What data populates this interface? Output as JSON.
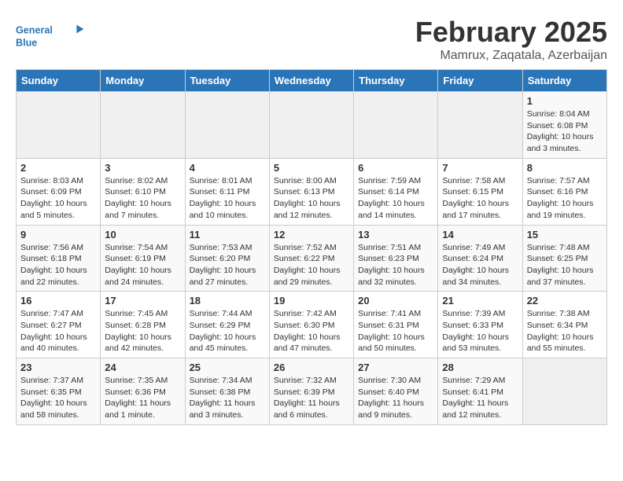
{
  "header": {
    "logo": {
      "general": "General",
      "blue": "Blue"
    },
    "title": "February 2025",
    "subtitle": "Mamrux, Zaqatala, Azerbaijan"
  },
  "calendar": {
    "weekdays": [
      "Sunday",
      "Monday",
      "Tuesday",
      "Wednesday",
      "Thursday",
      "Friday",
      "Saturday"
    ],
    "weeks": [
      [
        {
          "day": "",
          "info": ""
        },
        {
          "day": "",
          "info": ""
        },
        {
          "day": "",
          "info": ""
        },
        {
          "day": "",
          "info": ""
        },
        {
          "day": "",
          "info": ""
        },
        {
          "day": "",
          "info": ""
        },
        {
          "day": "1",
          "info": "Sunrise: 8:04 AM\nSunset: 6:08 PM\nDaylight: 10 hours and 3 minutes."
        }
      ],
      [
        {
          "day": "2",
          "info": "Sunrise: 8:03 AM\nSunset: 6:09 PM\nDaylight: 10 hours and 5 minutes."
        },
        {
          "day": "3",
          "info": "Sunrise: 8:02 AM\nSunset: 6:10 PM\nDaylight: 10 hours and 7 minutes."
        },
        {
          "day": "4",
          "info": "Sunrise: 8:01 AM\nSunset: 6:11 PM\nDaylight: 10 hours and 10 minutes."
        },
        {
          "day": "5",
          "info": "Sunrise: 8:00 AM\nSunset: 6:13 PM\nDaylight: 10 hours and 12 minutes."
        },
        {
          "day": "6",
          "info": "Sunrise: 7:59 AM\nSunset: 6:14 PM\nDaylight: 10 hours and 14 minutes."
        },
        {
          "day": "7",
          "info": "Sunrise: 7:58 AM\nSunset: 6:15 PM\nDaylight: 10 hours and 17 minutes."
        },
        {
          "day": "8",
          "info": "Sunrise: 7:57 AM\nSunset: 6:16 PM\nDaylight: 10 hours and 19 minutes."
        }
      ],
      [
        {
          "day": "9",
          "info": "Sunrise: 7:56 AM\nSunset: 6:18 PM\nDaylight: 10 hours and 22 minutes."
        },
        {
          "day": "10",
          "info": "Sunrise: 7:54 AM\nSunset: 6:19 PM\nDaylight: 10 hours and 24 minutes."
        },
        {
          "day": "11",
          "info": "Sunrise: 7:53 AM\nSunset: 6:20 PM\nDaylight: 10 hours and 27 minutes."
        },
        {
          "day": "12",
          "info": "Sunrise: 7:52 AM\nSunset: 6:22 PM\nDaylight: 10 hours and 29 minutes."
        },
        {
          "day": "13",
          "info": "Sunrise: 7:51 AM\nSunset: 6:23 PM\nDaylight: 10 hours and 32 minutes."
        },
        {
          "day": "14",
          "info": "Sunrise: 7:49 AM\nSunset: 6:24 PM\nDaylight: 10 hours and 34 minutes."
        },
        {
          "day": "15",
          "info": "Sunrise: 7:48 AM\nSunset: 6:25 PM\nDaylight: 10 hours and 37 minutes."
        }
      ],
      [
        {
          "day": "16",
          "info": "Sunrise: 7:47 AM\nSunset: 6:27 PM\nDaylight: 10 hours and 40 minutes."
        },
        {
          "day": "17",
          "info": "Sunrise: 7:45 AM\nSunset: 6:28 PM\nDaylight: 10 hours and 42 minutes."
        },
        {
          "day": "18",
          "info": "Sunrise: 7:44 AM\nSunset: 6:29 PM\nDaylight: 10 hours and 45 minutes."
        },
        {
          "day": "19",
          "info": "Sunrise: 7:42 AM\nSunset: 6:30 PM\nDaylight: 10 hours and 47 minutes."
        },
        {
          "day": "20",
          "info": "Sunrise: 7:41 AM\nSunset: 6:31 PM\nDaylight: 10 hours and 50 minutes."
        },
        {
          "day": "21",
          "info": "Sunrise: 7:39 AM\nSunset: 6:33 PM\nDaylight: 10 hours and 53 minutes."
        },
        {
          "day": "22",
          "info": "Sunrise: 7:38 AM\nSunset: 6:34 PM\nDaylight: 10 hours and 55 minutes."
        }
      ],
      [
        {
          "day": "23",
          "info": "Sunrise: 7:37 AM\nSunset: 6:35 PM\nDaylight: 10 hours and 58 minutes."
        },
        {
          "day": "24",
          "info": "Sunrise: 7:35 AM\nSunset: 6:36 PM\nDaylight: 11 hours and 1 minute."
        },
        {
          "day": "25",
          "info": "Sunrise: 7:34 AM\nSunset: 6:38 PM\nDaylight: 11 hours and 3 minutes."
        },
        {
          "day": "26",
          "info": "Sunrise: 7:32 AM\nSunset: 6:39 PM\nDaylight: 11 hours and 6 minutes."
        },
        {
          "day": "27",
          "info": "Sunrise: 7:30 AM\nSunset: 6:40 PM\nDaylight: 11 hours and 9 minutes."
        },
        {
          "day": "28",
          "info": "Sunrise: 7:29 AM\nSunset: 6:41 PM\nDaylight: 11 hours and 12 minutes."
        },
        {
          "day": "",
          "info": ""
        }
      ]
    ]
  }
}
